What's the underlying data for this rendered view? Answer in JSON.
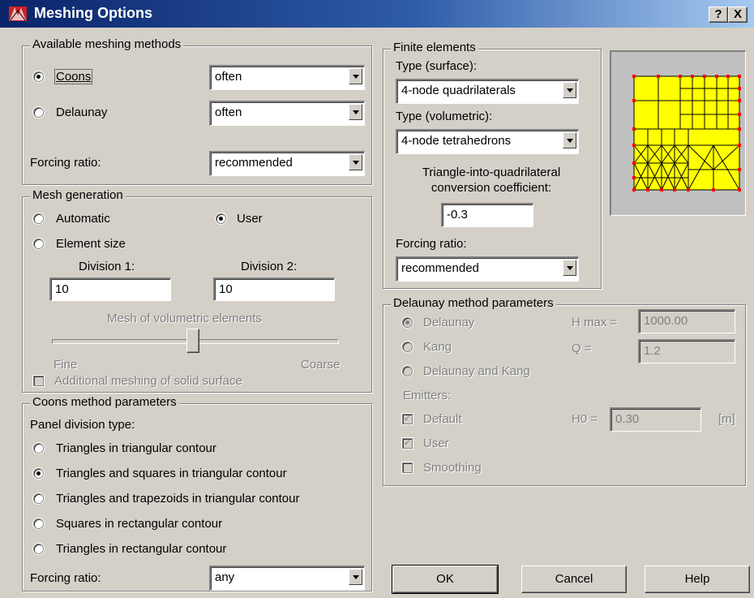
{
  "window": {
    "title": "Meshing Options",
    "help_glyph": "?",
    "close_glyph": "X"
  },
  "methods": {
    "legend": "Available meshing methods",
    "coons_label": "Coons",
    "coons_value": "often",
    "coons_selected": true,
    "delaunay_label": "Delaunay",
    "delaunay_value": "often",
    "forcing_label": "Forcing ratio:",
    "forcing_value": "recommended"
  },
  "mesh_generation": {
    "legend": "Mesh generation",
    "automatic_label": "Automatic",
    "user_label": "User",
    "user_selected": true,
    "element_size_label": "Element size",
    "division1_label": "Division 1:",
    "division1_value": "10",
    "division2_label": "Division 2:",
    "division2_value": "10",
    "volumetric_label": "Mesh of volumetric elements",
    "slider_level": 0.5,
    "fine_label": "Fine",
    "coarse_label": "Coarse",
    "additional_label": "Additional meshing of solid surface",
    "additional_checked": false
  },
  "coons": {
    "legend": "Coons method parameters",
    "panel_label": "Panel division type:",
    "options": [
      {
        "label": "Triangles in triangular contour",
        "selected": false
      },
      {
        "label": "Triangles and squares in triangular contour",
        "selected": true
      },
      {
        "label": "Triangles and trapezoids in triangular contour",
        "selected": false
      },
      {
        "label": "Squares in rectangular contour",
        "selected": false
      },
      {
        "label": "Triangles in rectangular contour",
        "selected": false
      }
    ],
    "forcing_label": "Forcing ratio:",
    "forcing_value": "any"
  },
  "finite": {
    "legend": "Finite elements",
    "surface_label": "Type (surface):",
    "surface_value": "4-node quadrilaterals",
    "volumetric_label": "Type (volumetric):",
    "volumetric_value": "4-node tetrahedrons",
    "coef_label1": "Triangle-into-quadrilateral",
    "coef_label2": "conversion coefficient:",
    "coef_value": "-0.3",
    "forcing_label": "Forcing ratio:",
    "forcing_value": "recommended"
  },
  "delaunay": {
    "legend": "Delaunay method parameters",
    "opt_delaunay": "Delaunay",
    "opt_kang": "Kang",
    "opt_both": "Delaunay and Kang",
    "hmax_label": "H max =",
    "hmax_value": "1000.00",
    "q_label": "Q =",
    "q_value": "1.2",
    "emitters_label": "Emitters:",
    "default_label": "Default",
    "default_checked": true,
    "h0_label": "H0 =",
    "h0_value": "0.30",
    "unit_label": "[m]",
    "user_label": "User",
    "user_checked": true,
    "smoothing_label": "Smoothing",
    "smoothing_checked": false
  },
  "buttons": {
    "ok": "OK",
    "cancel": "Cancel",
    "help": "Help"
  },
  "colors": {
    "preview_fill": "#ffff00",
    "preview_nodes": "#ff0000",
    "title_bar": "#0a246a"
  }
}
